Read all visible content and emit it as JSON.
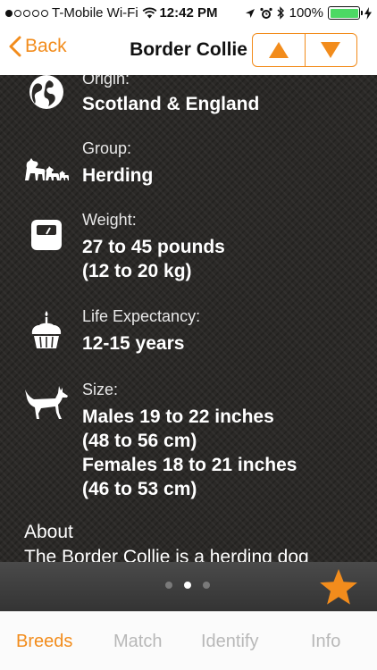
{
  "status_bar": {
    "carrier": "T-Mobile Wi-Fi",
    "time": "12:42 PM",
    "battery": "100%",
    "signal_dots_filled": 1,
    "signal_dots_total": 5
  },
  "nav": {
    "back_label": "Back",
    "title": "Border Collie",
    "prev_icon": "triangle-up-icon",
    "next_icon": "triangle-down-icon"
  },
  "details": [
    {
      "icon": "globe-icon",
      "label": "Origin:",
      "value": "Scotland & England"
    },
    {
      "icon": "dogs-group-icon",
      "label": "Group:",
      "value": "Herding"
    },
    {
      "icon": "scale-icon",
      "label": "Weight:",
      "value": "27 to 45 pounds\n(12 to 20 kg)"
    },
    {
      "icon": "cupcake-icon",
      "label": "Life Expectancy:",
      "value": "12-15 years"
    },
    {
      "icon": "dog-silhouette-icon",
      "label": "Size:",
      "value": "Males 19 to 22 inches\n(48 to 56 cm)\nFemales 18 to 21 inches\n(46 to 53 cm)"
    }
  ],
  "about": {
    "label": "About",
    "text": "The Border Collie is a herding dog"
  },
  "pager": {
    "pages": 3,
    "current": 2
  },
  "tabs": [
    {
      "label": "Breeds",
      "selected": true
    },
    {
      "label": "Match",
      "selected": false
    },
    {
      "label": "Identify",
      "selected": false
    },
    {
      "label": "Info",
      "selected": false
    }
  ],
  "colors": {
    "accent": "#f28c1c",
    "battery_green": "#4cd964",
    "content_bg": "#2b2927",
    "tab_inactive": "#b8b8b8"
  }
}
